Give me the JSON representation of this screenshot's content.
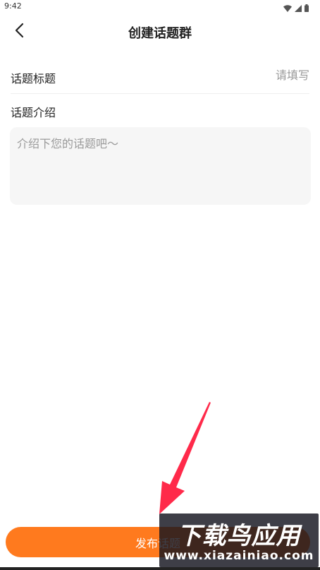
{
  "status_bar": {
    "time": "9:42",
    "icons": [
      "wifi-icon",
      "signal-icon",
      "battery-icon"
    ]
  },
  "nav": {
    "back_icon": "chevron-left-icon",
    "title": "创建话题群"
  },
  "form": {
    "topic_title_label": "话题标题",
    "topic_title_placeholder": "请填写",
    "topic_intro_label": "话题介绍",
    "topic_intro_placeholder": "介绍下您的话题吧～"
  },
  "publish_button": {
    "label": "发布话题"
  },
  "watermark": {
    "title": "下载鸟应用",
    "url": "www.xiazainiao.com"
  },
  "colors": {
    "accent": "#ff7a1e",
    "textarea_bg": "#f6f6f6",
    "placeholder": "#999999",
    "arrow": "#ff2a4a"
  }
}
